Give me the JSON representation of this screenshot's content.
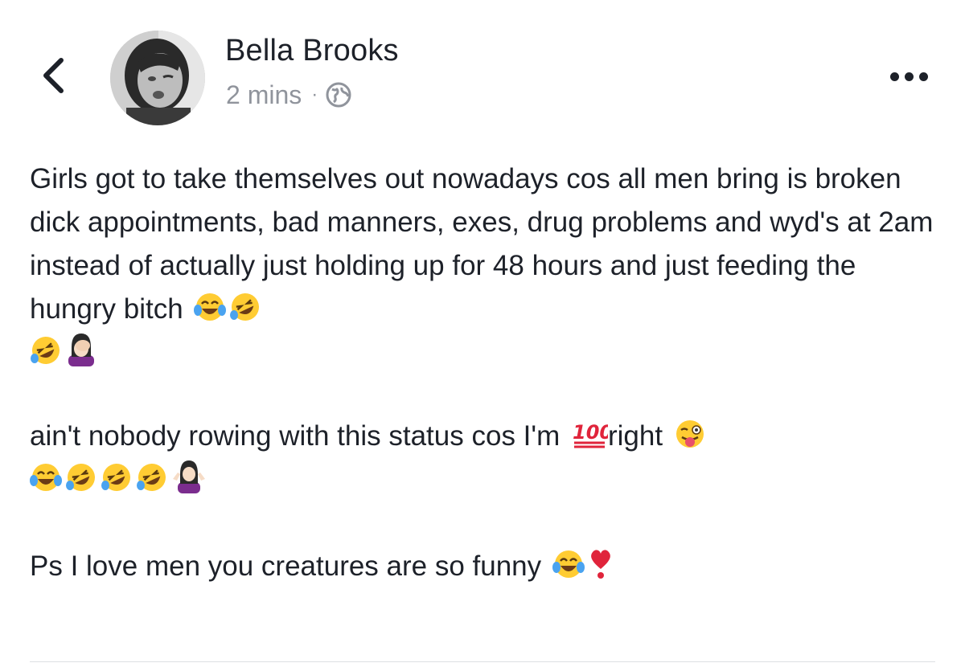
{
  "header": {
    "back_icon": "chevron-left-icon",
    "author_name": "Bella Brooks",
    "timestamp": "2 mins",
    "separator": "·",
    "privacy_icon": "globe-icon",
    "more_icon": "more-horizontal-icon"
  },
  "post": {
    "paragraph_1_text": "Girls got to take themselves out nowadays cos all men bring is broken dick appointments, bad manners, exes, drug problems and wyd's at 2am instead of actually just holding up for 48 hours and just feeding the hungry bitch",
    "paragraph_1_emojis": [
      "😂",
      "🤣",
      "🤣",
      "🤦🏻‍♀️"
    ],
    "paragraph_2_text_a": "ain't nobody rowing with this status cos I'm",
    "paragraph_2_inline_emoji": "💯",
    "paragraph_2_text_b": "right",
    "paragraph_2_emojis": [
      "😜",
      "😂",
      "🤣",
      "🤣",
      "🤣",
      "🤷🏻‍♀️"
    ],
    "paragraph_3_text": "Ps I love men you creatures are so funny",
    "paragraph_3_emojis": [
      "😂",
      "❣️"
    ]
  },
  "colors": {
    "text": "#1d2129",
    "meta": "#90949c",
    "emoji_face": "#ffcc33",
    "hundred_red": "#e0243b"
  }
}
